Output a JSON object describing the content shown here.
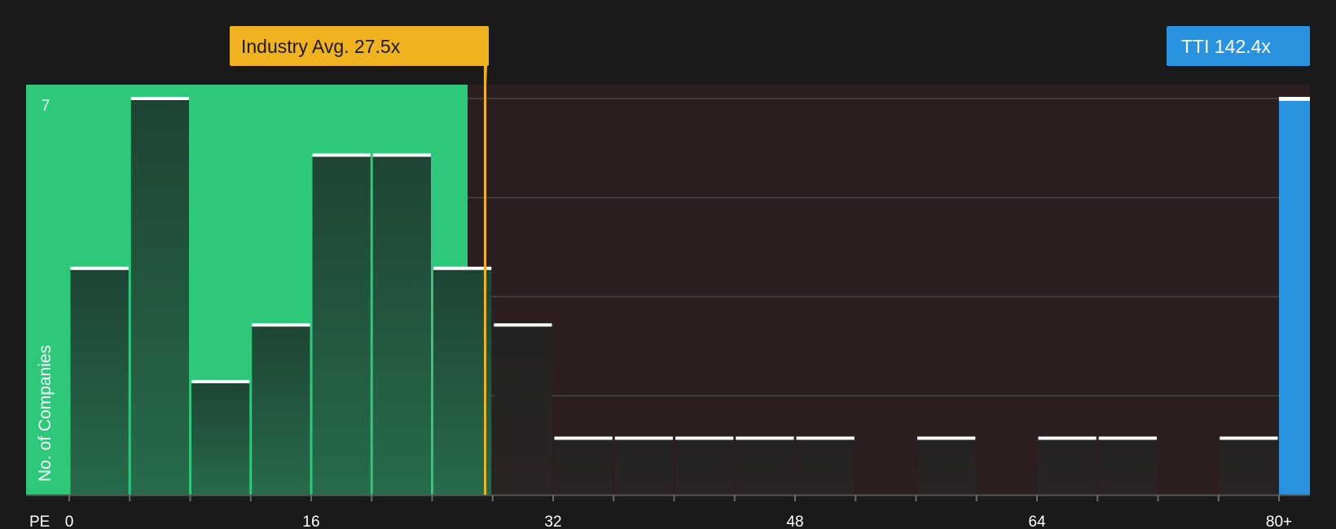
{
  "chart_data": {
    "type": "bar",
    "xlabel": "PE",
    "ylabel": "No. of Companies",
    "x_tick_labels": [
      "0",
      "16",
      "32",
      "48",
      "64",
      "80+"
    ],
    "x_ticks": [
      0,
      16,
      32,
      48,
      64,
      80
    ],
    "y_tick_labels": [
      "7"
    ],
    "ylim": [
      0,
      7
    ],
    "bin_width": 4,
    "bins": [
      {
        "start": 0,
        "end": 4,
        "count": 4
      },
      {
        "start": 4,
        "end": 8,
        "count": 7
      },
      {
        "start": 8,
        "end": 12,
        "count": 2
      },
      {
        "start": 12,
        "end": 16,
        "count": 3
      },
      {
        "start": 16,
        "end": 20,
        "count": 6
      },
      {
        "start": 20,
        "end": 24,
        "count": 6
      },
      {
        "start": 24,
        "end": 28,
        "count": 4
      },
      {
        "start": 28,
        "end": 32,
        "count": 3
      },
      {
        "start": 32,
        "end": 36,
        "count": 1
      },
      {
        "start": 36,
        "end": 40,
        "count": 1
      },
      {
        "start": 40,
        "end": 44,
        "count": 1
      },
      {
        "start": 44,
        "end": 48,
        "count": 1
      },
      {
        "start": 48,
        "end": 52,
        "count": 1
      },
      {
        "start": 52,
        "end": 56,
        "count": 0
      },
      {
        "start": 56,
        "end": 60,
        "count": 1
      },
      {
        "start": 60,
        "end": 64,
        "count": 0
      },
      {
        "start": 64,
        "end": 68,
        "count": 1
      },
      {
        "start": 68,
        "end": 72,
        "count": 1
      },
      {
        "start": 72,
        "end": 76,
        "count": 0
      },
      {
        "start": 76,
        "end": 80,
        "count": 1
      },
      {
        "start": 80,
        "end": null,
        "count": 7,
        "highlight": true
      }
    ],
    "industry_avg": {
      "label": "Industry Avg. 27.5x",
      "value": 27.5
    },
    "company": {
      "label": "TTI 142.4x",
      "value": 142.4
    },
    "grid": true,
    "colors": {
      "background": "#1a1a1a",
      "below_avg_region": "#2ec87a",
      "above_avg_region": "#2d1f1f",
      "bar_below": "#1f4a36",
      "bar_above": "#242424",
      "bar_top": "#ffffff",
      "industry_avg": "#f0b21e",
      "company": "#2a93e0",
      "gridline": "#4a4a4a"
    }
  }
}
